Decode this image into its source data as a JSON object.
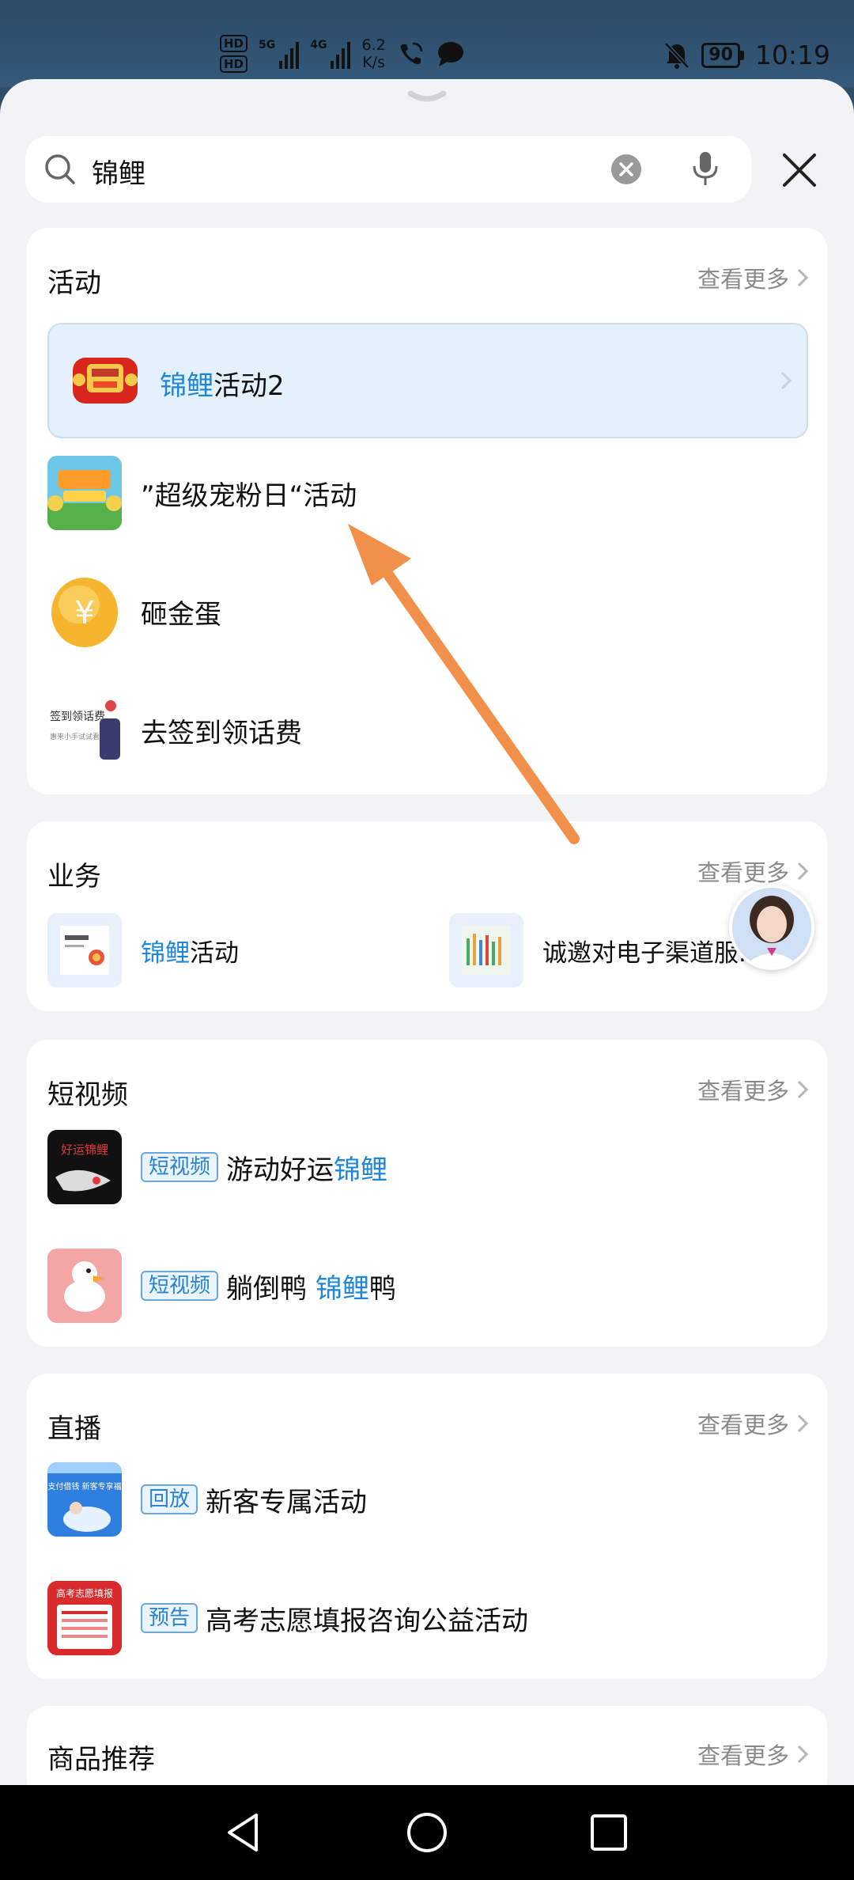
{
  "status_bar": {
    "hd_top": "HD",
    "hd_bottom": "HD",
    "net1": "5G",
    "net2": "4G",
    "speed_value": "6.2",
    "speed_unit": "K/s",
    "battery": "90",
    "time": "10:19"
  },
  "search": {
    "query": "锦鲤"
  },
  "activities": {
    "title": "活动",
    "more": "查看更多",
    "items": [
      {
        "hl": "锦鲤",
        "rest": "活动2"
      },
      {
        "text": "”超级宠粉日“活动"
      },
      {
        "text": "砸金蛋"
      },
      {
        "text": "去签到领话费"
      }
    ],
    "thumb_texts": {
      "egg": "¥",
      "signin_line1": "签到领话费",
      "signin_line2": "惠来小手试试看"
    }
  },
  "business": {
    "title": "业务",
    "more": "查看更多",
    "items": [
      {
        "hl": "锦鲤",
        "rest": "活动"
      },
      {
        "text": "诚邀对电子渠道服..."
      }
    ]
  },
  "short_video": {
    "title": "短视频",
    "more": "查看更多",
    "items": [
      {
        "tag": "短视频",
        "text": "游动好运",
        "hl": "锦鲤",
        "thumb_label": "好运锦鲤"
      },
      {
        "tag": "短视频",
        "text": "躺倒鸭 ",
        "hl": "锦鲤",
        "rest": "鸭"
      }
    ]
  },
  "live": {
    "title": "直播",
    "more": "查看更多",
    "items": [
      {
        "tag": "回放",
        "text": "新客专属活动",
        "thumb_label": "翼支付借钱 新客专享福利"
      },
      {
        "tag": "预告",
        "text": "高考志愿填报咨询公益活动",
        "thumb_label": "高考志愿填报"
      }
    ]
  },
  "products": {
    "title": "商品推荐",
    "more": "查看更多"
  },
  "colors": {
    "highlight": "#1e87d8",
    "arrow": "#f0904a",
    "nav_bg": "#000000"
  }
}
